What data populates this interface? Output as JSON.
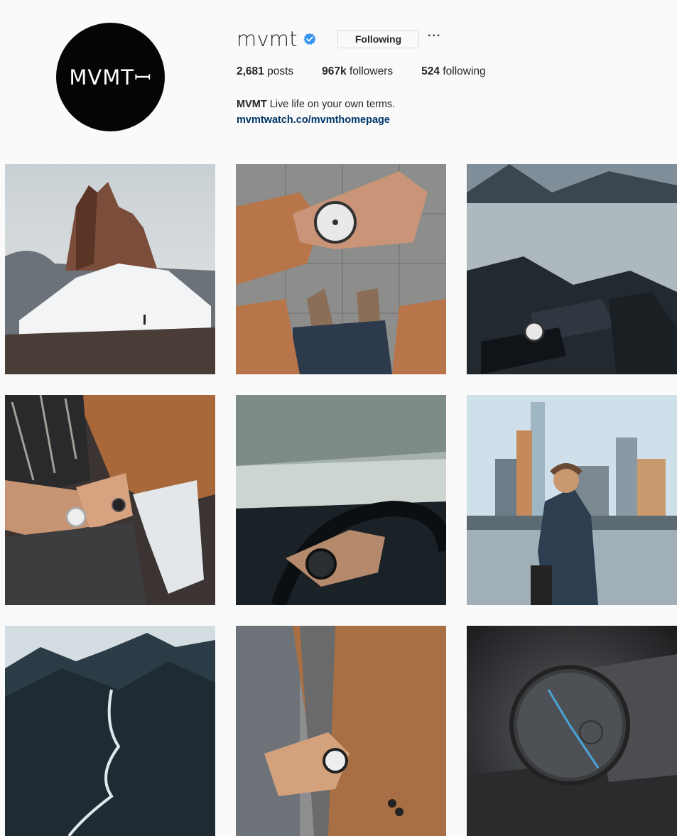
{
  "profile": {
    "avatar_text": "MVMTꟷ",
    "username": "mvmt",
    "verified_icon": "verified-badge-icon",
    "follow_button_label": "Following",
    "more_label": "···",
    "stats": {
      "posts_count": "2,681",
      "posts_label": "posts",
      "followers_count": "967k",
      "followers_label": "followers",
      "following_count": "524",
      "following_label": "following"
    },
    "bio": {
      "name": "MVMT",
      "text": "Live life on your own terms.",
      "link": "mvmtwatch.co/mvmthomepage"
    }
  },
  "grid": {
    "posts": [
      {
        "subject": "mountain-peak-hiker"
      },
      {
        "subject": "wrist-watch-over-shoes"
      },
      {
        "subject": "frozen-lake-wrist-watch"
      },
      {
        "subject": "couple-holding-hands-watch"
      },
      {
        "subject": "driving-wheel-watch"
      },
      {
        "subject": "man-city-skyline"
      },
      {
        "subject": "mountain-river-aerial"
      },
      {
        "subject": "coat-wrist-watch"
      },
      {
        "subject": "black-chronograph-watch"
      }
    ]
  },
  "colors": {
    "background": "#fafafa",
    "verified": "#3897f0",
    "link": "#003569",
    "text": "#262626"
  }
}
